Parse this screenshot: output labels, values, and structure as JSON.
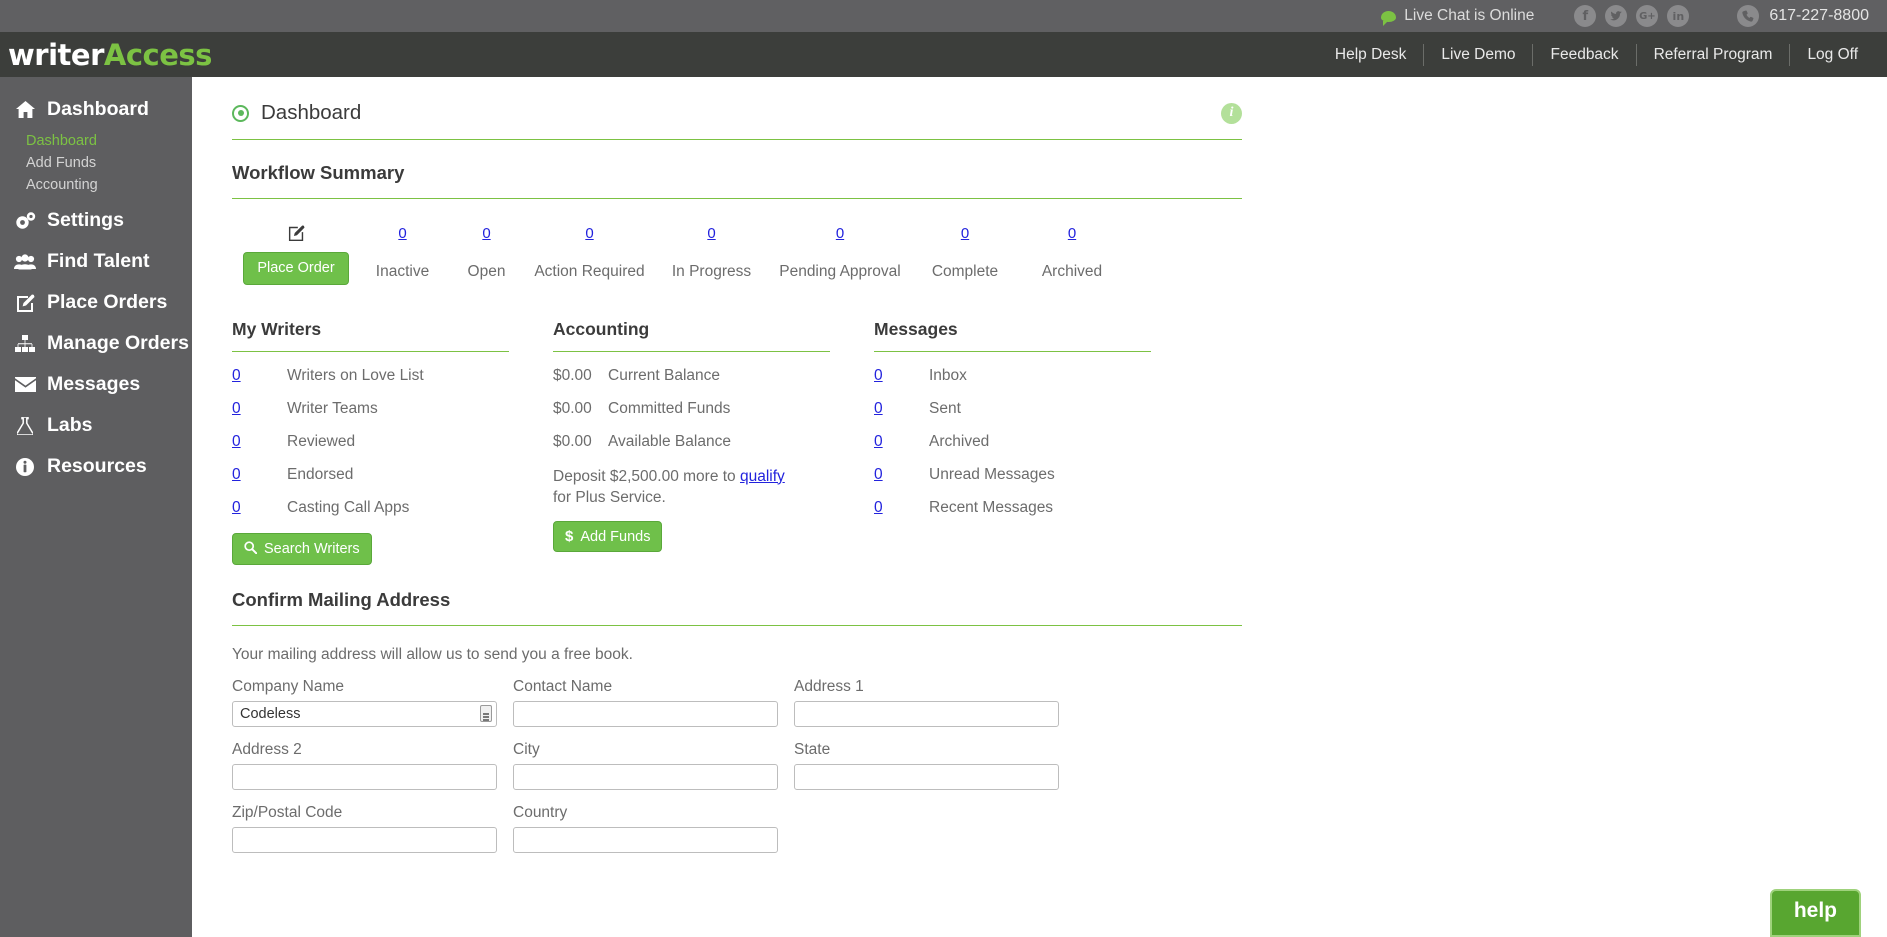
{
  "topbar": {
    "live_chat": "Live Chat is Online",
    "chat_icon": "chat-bubble-icon",
    "social": [
      {
        "name": "facebook-icon",
        "glyph": "f"
      },
      {
        "name": "twitter-icon",
        "glyph": "ᵛ"
      },
      {
        "name": "google-plus-icon",
        "glyph": "G+"
      },
      {
        "name": "linkedin-icon",
        "glyph": "in"
      }
    ],
    "phone_icon": "phone-icon",
    "phone": "617-227-8800"
  },
  "brand": {
    "part1": "writer",
    "part2": "Access"
  },
  "nav": {
    "links": [
      "Help Desk",
      "Live Demo",
      "Feedback",
      "Referral Program",
      "Log Off"
    ]
  },
  "sidebar": {
    "items": [
      {
        "label": "Dashboard",
        "icon": "home-icon",
        "glyph": "⌂"
      },
      {
        "label": "Settings",
        "icon": "gears-icon",
        "glyph": "⚙"
      },
      {
        "label": "Find Talent",
        "icon": "users-icon",
        "glyph": "♟"
      },
      {
        "label": "Place Orders",
        "icon": "edit-square-icon",
        "glyph": "✎"
      },
      {
        "label": "Manage Orders",
        "icon": "sitemap-icon",
        "glyph": "⑂"
      },
      {
        "label": "Messages",
        "icon": "envelope-icon",
        "glyph": "✉"
      },
      {
        "label": "Labs",
        "icon": "flask-icon",
        "glyph": "⚗"
      },
      {
        "label": "Resources",
        "icon": "info-circle-icon",
        "glyph": "ℹ"
      }
    ],
    "sub_items": [
      {
        "label": "Dashboard",
        "active": true
      },
      {
        "label": "Add Funds",
        "active": false
      },
      {
        "label": "Accounting",
        "active": false
      }
    ]
  },
  "page": {
    "title": "Dashboard",
    "title_icon": "target-circle-icon",
    "info_icon": "info-icon"
  },
  "workflow": {
    "heading": "Workflow Summary",
    "place_order_icon": "pencil-square-icon",
    "place_order_label": "Place Order",
    "statuses": [
      {
        "label": "Inactive",
        "count": "0"
      },
      {
        "label": "Open",
        "count": "0"
      },
      {
        "label": "Action Required",
        "count": "0"
      },
      {
        "label": "In Progress",
        "count": "0"
      },
      {
        "label": "Pending Approval",
        "count": "0"
      },
      {
        "label": "Complete",
        "count": "0"
      },
      {
        "label": "Archived",
        "count": "0"
      }
    ]
  },
  "my_writers": {
    "heading": "My Writers",
    "rows": [
      {
        "count": "0",
        "label": "Writers on Love List"
      },
      {
        "count": "0",
        "label": "Writer Teams"
      },
      {
        "count": "0",
        "label": "Reviewed"
      },
      {
        "count": "0",
        "label": "Endorsed"
      },
      {
        "count": "0",
        "label": "Casting Call Apps"
      }
    ],
    "button_icon": "search-icon",
    "button_label": "Search Writers"
  },
  "accounting": {
    "heading": "Accounting",
    "rows": [
      {
        "amount": "$0.00",
        "label": "Current Balance"
      },
      {
        "amount": "$0.00",
        "label": "Committed Funds"
      },
      {
        "amount": "$0.00",
        "label": "Available Balance"
      }
    ],
    "note_pre": "Deposit $2,500.00 more to ",
    "note_link": "qualify",
    "note_post": " for Plus Service.",
    "button_icon": "dollar-icon",
    "button_label": "Add Funds"
  },
  "messages": {
    "heading": "Messages",
    "rows": [
      {
        "count": "0",
        "label": "Inbox"
      },
      {
        "count": "0",
        "label": "Sent"
      },
      {
        "count": "0",
        "label": "Archived"
      },
      {
        "count": "0",
        "label": "Unread Messages"
      },
      {
        "count": "0",
        "label": "Recent Messages"
      }
    ]
  },
  "address_form": {
    "heading": "Confirm Mailing Address",
    "lede": "Your mailing address will allow us to send you a free book.",
    "fields": [
      {
        "label": "Company Name",
        "value": "Codeless",
        "autofill": true
      },
      {
        "label": "Contact Name",
        "value": "",
        "autofill": false
      },
      {
        "label": "Address 1",
        "value": "",
        "autofill": false
      },
      {
        "label": "Address 2",
        "value": "",
        "autofill": false
      },
      {
        "label": "City",
        "value": "",
        "autofill": false
      },
      {
        "label": "State",
        "value": "",
        "autofill": false
      },
      {
        "label": "Zip/Postal Code",
        "value": "",
        "autofill": false
      },
      {
        "label": "Country",
        "value": "",
        "autofill": false
      }
    ]
  },
  "help_widget": {
    "label": "help"
  },
  "colors": {
    "brand_green": "#7cc243",
    "button_green": "#6fc04a",
    "topbar_gray": "#606062",
    "navbar_dark": "#3c3e3b",
    "sidebar_gray": "#5e5e60",
    "link_blue": "#2222dd"
  }
}
